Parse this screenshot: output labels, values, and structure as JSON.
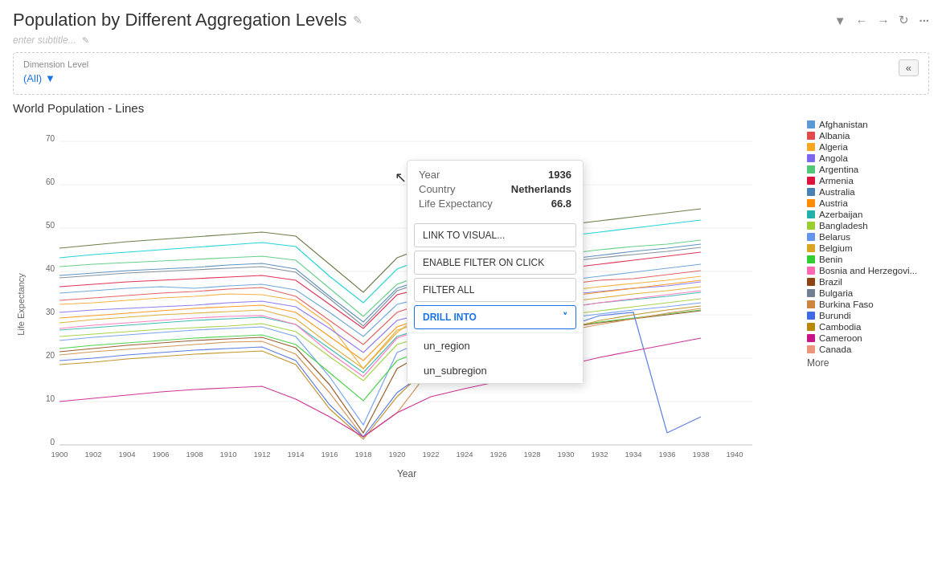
{
  "header": {
    "title": "Population by Different Aggregation Levels",
    "edit_icon": "✎",
    "subtitle_placeholder": "enter subtitle...",
    "actions": {
      "filter": "▼",
      "back": "←",
      "forward": "→",
      "refresh": "↺",
      "more": "···"
    }
  },
  "filter_panel": {
    "label": "Dimension Level",
    "value": "(All)",
    "collapse_icon": "«"
  },
  "chart": {
    "title": "World Population - Lines",
    "y_axis_label": "Life Expectancy",
    "x_axis_label": "Year",
    "y_max": 70,
    "y_min": 0,
    "y_ticks": [
      0,
      10,
      20,
      30,
      40,
      50,
      60,
      70
    ]
  },
  "tooltip": {
    "year_label": "Year",
    "year_value": "1936",
    "country_label": "Country",
    "country_value": "Netherlands",
    "life_exp_label": "Life Expectancy",
    "life_exp_value": "66.8",
    "btn_link": "LINK TO VISUAL...",
    "btn_filter": "ENABLE FILTER ON CLICK",
    "btn_filter_all": "FILTER ALL",
    "btn_drill": "DRILL INTO",
    "drill_chevron": "˅",
    "drill_options": [
      "un_region",
      "un_subregion"
    ]
  },
  "legend": {
    "items": [
      {
        "name": "Afghanistan",
        "color": "#5b9bd5"
      },
      {
        "name": "Albania",
        "color": "#e04a4a"
      },
      {
        "name": "Algeria",
        "color": "#f5a623"
      },
      {
        "name": "Angola",
        "color": "#7b68ee"
      },
      {
        "name": "Argentina",
        "color": "#50c878"
      },
      {
        "name": "Armenia",
        "color": "#dc143c"
      },
      {
        "name": "Australia",
        "color": "#4682b4"
      },
      {
        "name": "Austria",
        "color": "#ff8c00"
      },
      {
        "name": "Azerbaijan",
        "color": "#20b2aa"
      },
      {
        "name": "Bangladesh",
        "color": "#9acd32"
      },
      {
        "name": "Belarus",
        "color": "#6495ed"
      },
      {
        "name": "Belgium",
        "color": "#daa520"
      },
      {
        "name": "Benin",
        "color": "#32cd32"
      },
      {
        "name": "Bosnia and Herzegovi...",
        "color": "#ff69b4"
      },
      {
        "name": "Brazil",
        "color": "#8b4513"
      },
      {
        "name": "Bulgaria",
        "color": "#708090"
      },
      {
        "name": "Burkina Faso",
        "color": "#cd853f"
      },
      {
        "name": "Burundi",
        "color": "#4169e1"
      },
      {
        "name": "Cambodia",
        "color": "#b8860b"
      },
      {
        "name": "Cameroon",
        "color": "#c71585"
      },
      {
        "name": "Canada",
        "color": "#e9967a"
      }
    ],
    "more_label": "More"
  }
}
